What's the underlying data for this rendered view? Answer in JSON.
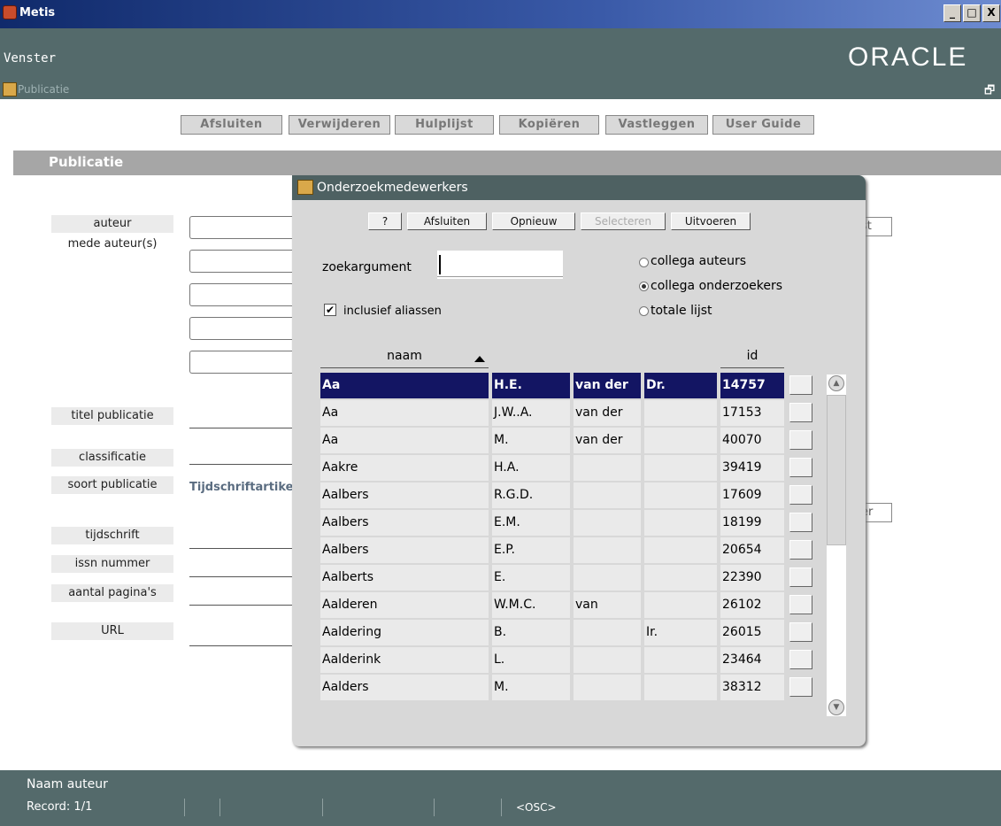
{
  "window": {
    "title": "Metis",
    "menu": "Venster",
    "brand": "ORACLE",
    "min": "_",
    "max": "□",
    "close": "X"
  },
  "form": {
    "title": "Publicatie",
    "restore": "🗗",
    "toolbar": [
      "Afsluiten",
      "Verwijderen",
      "Hulplijst",
      "Kopiëren",
      "Vastleggen",
      "User Guide"
    ],
    "section": "Publicatie",
    "labels": {
      "auteur": "auteur",
      "mede": "mede auteur(s)",
      "titel": "titel publicatie",
      "classificatie": "classificatie",
      "soort": "soort publicatie",
      "tijdschrift": "tijdschrift",
      "issn": "issn nummer",
      "paginas": "aantal pagina's",
      "url": "URL"
    },
    "soort_value": "Tijdschriftartikel",
    "right_btn1": "st",
    "right_btn2": "er"
  },
  "dialog": {
    "title": "Onderzoekmedewerkers",
    "buttons": [
      "?",
      "Afsluiten",
      "Opnieuw",
      "Selecteren",
      "Uitvoeren"
    ],
    "zoek_label": "zoekargument",
    "zoek_value": "",
    "checkbox_label": "inclusief aliassen",
    "checkbox_mark": "✔",
    "radios": [
      "collega auteurs",
      "collega onderzoekers",
      "totale lijst"
    ],
    "selected_radio": 1,
    "columns": {
      "naam": "naam",
      "id": "id"
    },
    "rows": [
      [
        "Aa",
        "H.E.",
        "van der",
        "Dr.",
        "14757"
      ],
      [
        "Aa",
        "J.W..A.",
        "van der",
        "",
        "17153"
      ],
      [
        "Aa",
        "M.",
        "van der",
        "",
        "40070"
      ],
      [
        "Aakre",
        "H.A.",
        "",
        "",
        "39419"
      ],
      [
        "Aalbers",
        "R.G.D.",
        "",
        "",
        "17609"
      ],
      [
        "Aalbers",
        "E.M.",
        "",
        "",
        "18199"
      ],
      [
        "Aalbers",
        "E.P.",
        "",
        "",
        "20654"
      ],
      [
        "Aalberts",
        "E.",
        "",
        "",
        "22390"
      ],
      [
        "Aalderen",
        "W.M.C.",
        "van",
        "",
        "26102"
      ],
      [
        "Aaldering",
        "B.",
        "",
        "Ir.",
        "26015"
      ],
      [
        "Aalderink",
        "L.",
        "",
        "",
        "23464"
      ],
      [
        "Aalders",
        "M.",
        "",
        "",
        "38312"
      ]
    ],
    "selected_row": 0
  },
  "status": {
    "hint": "Naam auteur",
    "record": "Record: 1/1",
    "osc": "<OSC>"
  }
}
